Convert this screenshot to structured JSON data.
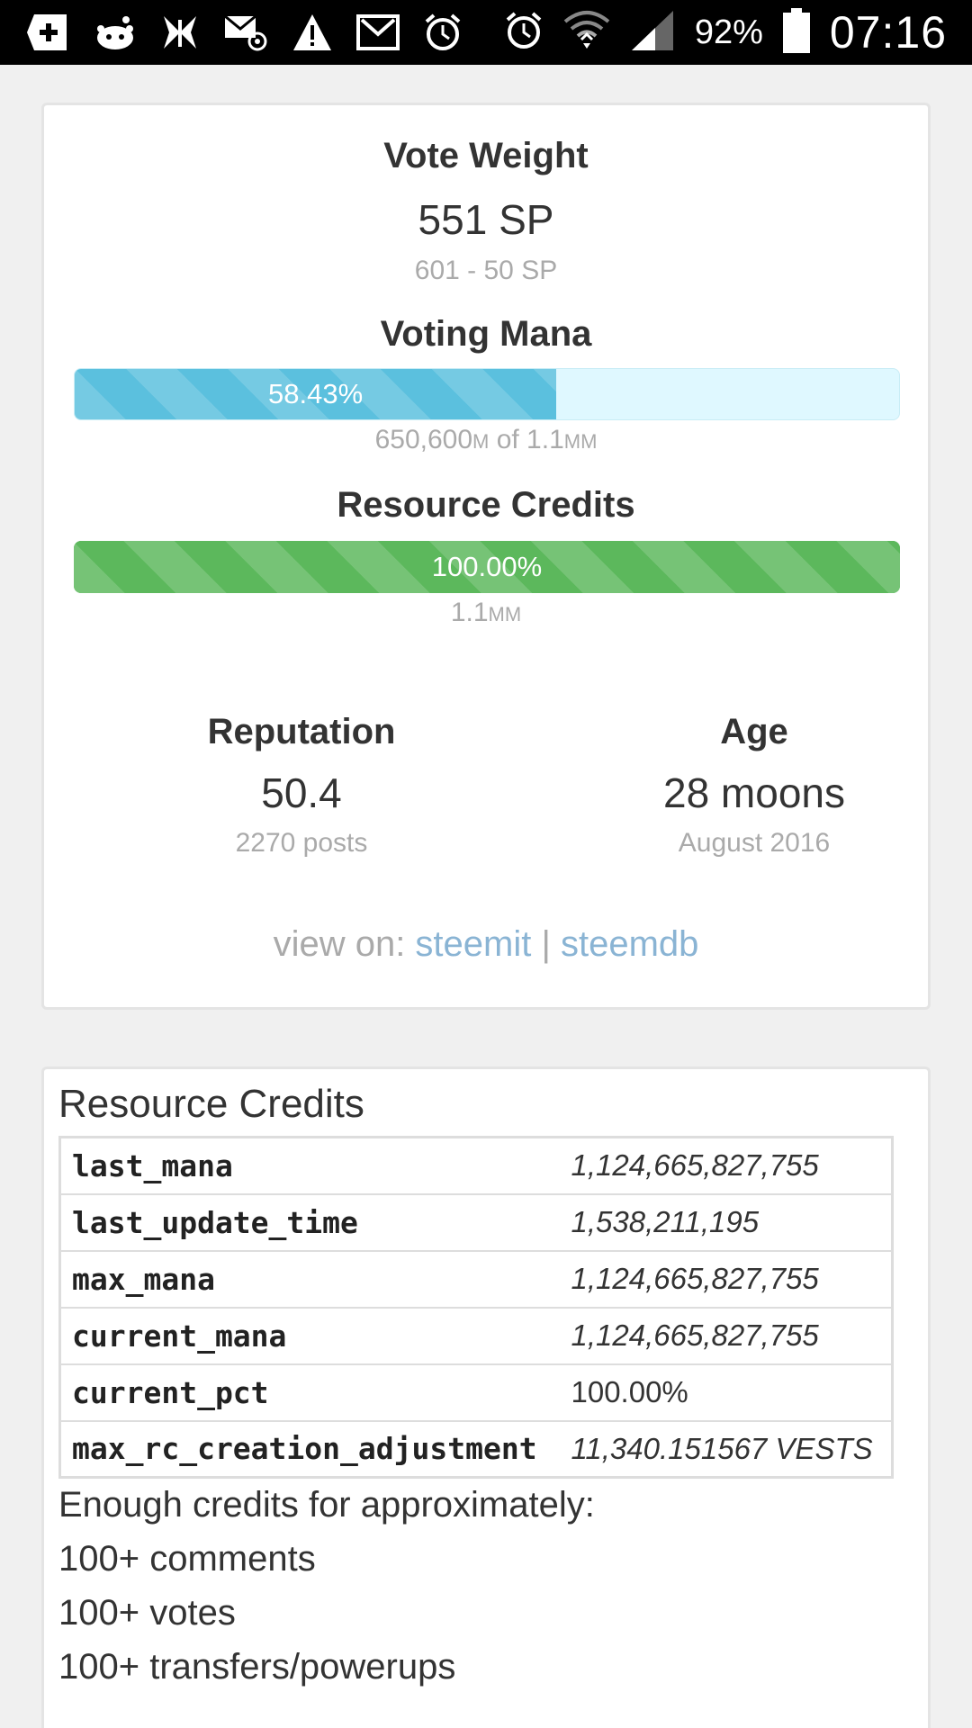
{
  "status_bar": {
    "battery": "92%",
    "clock": "07:16",
    "icons": [
      "add-box-icon",
      "reddit-icon",
      "butterfly-icon",
      "email-at-icon",
      "warning-icon",
      "gmail-icon",
      "alarm-icon",
      "alarm-icon",
      "wifi-icon",
      "signal-icon",
      "battery-icon"
    ]
  },
  "vote_weight": {
    "title": "Vote Weight",
    "value": "551 SP",
    "sub": "601 - 50 SP"
  },
  "voting_mana": {
    "title": "Voting Mana",
    "percent_label": "58.43%",
    "percent": 58.43,
    "sub_main": "650,600",
    "sub_unit1": "M",
    "sub_mid": " of 1.1",
    "sub_unit2": "MM",
    "color": "#5bc0de"
  },
  "resource_credits_bar": {
    "title": "Resource Credits",
    "percent_label": "100.00%",
    "percent": 100,
    "sub_main": "1.1",
    "sub_unit": "MM",
    "color": "#5cb85c"
  },
  "reputation": {
    "title": "Reputation",
    "value": "50.4",
    "sub": "2270 posts"
  },
  "age": {
    "title": "Age",
    "value": "28 moons",
    "sub": "August 2016"
  },
  "view_on": {
    "label": "view on: ",
    "link1": "steemit",
    "separator": "|",
    "link2": "steemdb"
  },
  "rc_panel": {
    "title": "Resource Credits",
    "rows": [
      {
        "key": "last_mana",
        "value": "1,124,665,827,755"
      },
      {
        "key": "last_update_time",
        "value": "1,538,211,195"
      },
      {
        "key": "max_mana",
        "value": "1,124,665,827,755"
      },
      {
        "key": "current_mana",
        "value": "1,124,665,827,755"
      },
      {
        "key": "current_pct",
        "value": "100.00%"
      },
      {
        "key": "max_rc_creation_adjustment",
        "value": "11,340.151567 VESTS"
      }
    ],
    "approx_heading": "Enough credits for approximately:",
    "approx_items": [
      "100+ comments",
      "100+ votes",
      "100+ transfers/powerups"
    ]
  }
}
